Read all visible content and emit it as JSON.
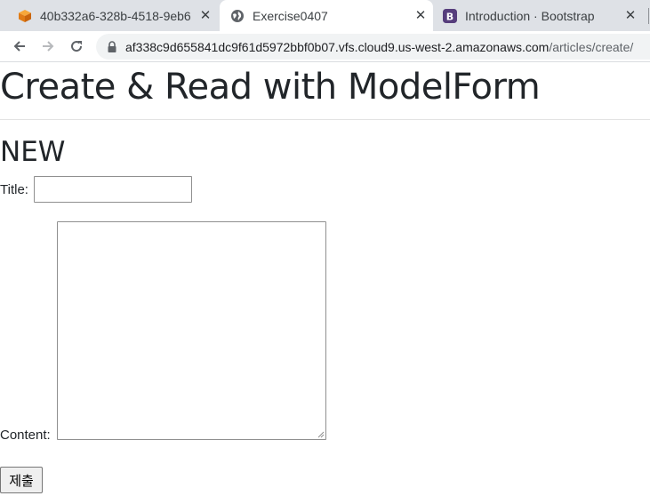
{
  "browser": {
    "tabs": [
      {
        "title": "40b332a6-328b-4518-9eb6",
        "icon": "cloud9-cube-icon",
        "active": false
      },
      {
        "title": "Exercise0407",
        "icon": "globe-icon",
        "active": true
      },
      {
        "title": "Introduction · Bootstrap",
        "icon": "bootstrap-icon",
        "active": false
      }
    ],
    "url_host": "af338c9d655841dc9f61d5972bbf0b07.vfs.cloud9.us-west-2.amazonaws.com",
    "url_path": "/articles/create/"
  },
  "page": {
    "title": "Create & Read with ModelForm",
    "section_heading": "NEW",
    "form": {
      "title_label": "Title:",
      "title_value": "",
      "content_label": "Content:",
      "content_value": "",
      "submit_label": "제출"
    }
  },
  "colors": {
    "tabstrip": "#dee1e6",
    "omnibox": "#f1f3f4",
    "text": "#212529"
  }
}
